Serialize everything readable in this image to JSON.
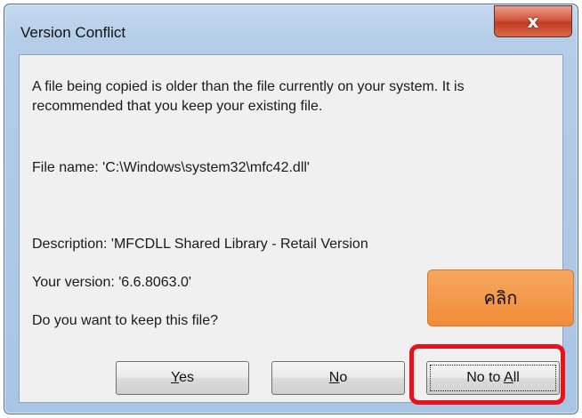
{
  "window": {
    "title": "Version Conflict",
    "close_glyph": "x",
    "close_icon": "close-icon"
  },
  "body": {
    "message": "A file being copied is older than the file currently on your system.  It is recommended that you keep your existing file.",
    "file_name": "File name:   'C:\\Windows\\system32\\mfc42.dll'",
    "description": "Description:  'MFCDLL Shared Library - Retail Version",
    "your_version": "Your version: '6.6.8063.0'",
    "question": "Do you want to keep this file?"
  },
  "buttons": {
    "yes": {
      "mnemonic": "Y",
      "rest": "es"
    },
    "no": {
      "mnemonic": "N",
      "rest": "o"
    },
    "no_to_all": {
      "prefix": "No to ",
      "mnemonic": "A",
      "rest": "ll"
    }
  },
  "annotation": {
    "callout_text": "คลิก",
    "highlight_color": "#e8121f",
    "callout_color": "#f08c38"
  }
}
